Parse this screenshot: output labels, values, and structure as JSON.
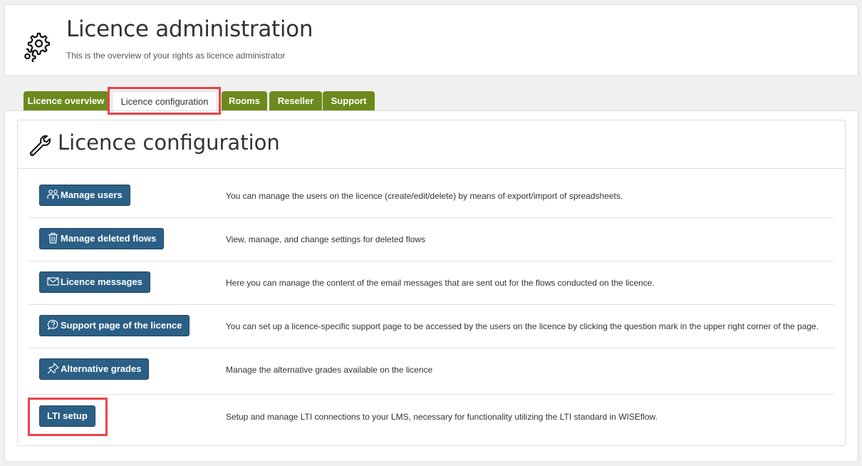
{
  "header": {
    "title": "Licence administration",
    "subtitle": "This is the overview of your rights as licence administrator"
  },
  "tabs": [
    {
      "label": "Licence overview",
      "active": false
    },
    {
      "label": "Licence configuration",
      "active": true
    },
    {
      "label": "Rooms",
      "active": false
    },
    {
      "label": "Reseller",
      "active": false
    },
    {
      "label": "Support",
      "active": false
    }
  ],
  "section": {
    "title": "Licence configuration"
  },
  "rows": [
    {
      "button": "Manage users",
      "icon": "users-icon",
      "description": "You can manage the users on the licence (create/edit/delete) by means of export/import of spreadsheets."
    },
    {
      "button": "Manage deleted flows",
      "icon": "trash-icon",
      "description": "View, manage, and change settings for deleted flows"
    },
    {
      "button": "Licence messages",
      "icon": "envelope-icon",
      "description": "Here you can manage the content of the email messages that are sent out for the flows conducted on the licence."
    },
    {
      "button": "Support page of the licence",
      "icon": "question-icon",
      "description": "You can set up a licence-specific support page to be accessed by the users on the licence by clicking the question mark in the upper right corner of the page."
    },
    {
      "button": "Alternative grades",
      "icon": "pin-icon",
      "description": "Manage the alternative grades available on the licence"
    },
    {
      "button": "LTI setup",
      "icon": "",
      "description": "Setup and manage LTI connections to your LMS, necessary for functionality utilizing the LTI standard in WISEflow."
    }
  ],
  "colors": {
    "tab_green": "#6c8a1b",
    "button_blue": "#2b5f85",
    "highlight_red": "#e8434b"
  }
}
